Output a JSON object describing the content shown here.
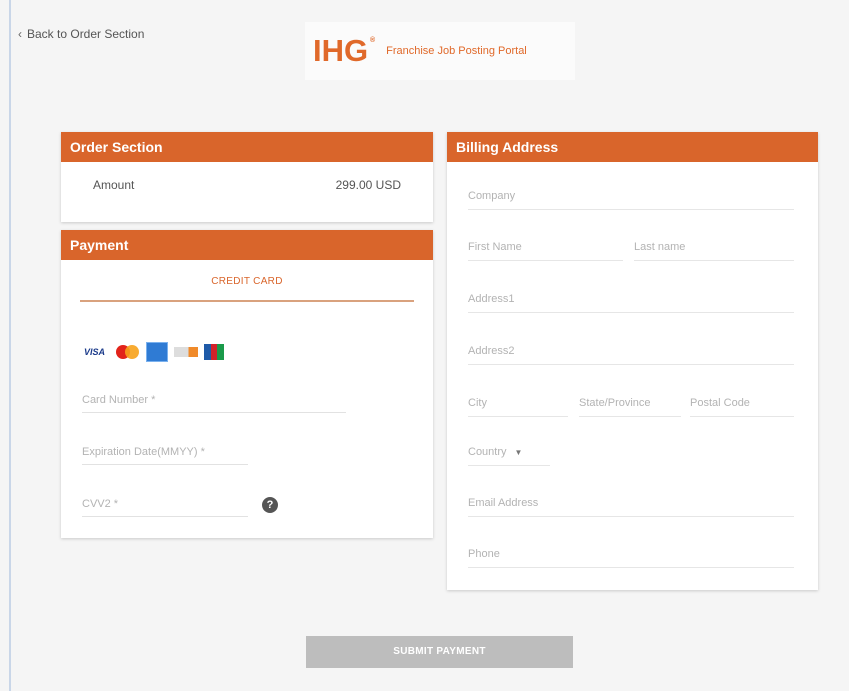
{
  "nav": {
    "back_label": "Back to Order Section"
  },
  "brand": {
    "logo_text": "IHG",
    "logo_mark": "®",
    "portal_title": "Franchise Job Posting Portal",
    "accent": "#d9652b"
  },
  "order": {
    "header": "Order Section",
    "amount_label": "Amount",
    "amount_value": "299.00 USD"
  },
  "payment": {
    "header": "Payment",
    "tab_credit_card": "CREDIT CARD",
    "card_brands": [
      "visa",
      "mastercard",
      "amex",
      "discover",
      "jcb"
    ],
    "visa_label": "VISA",
    "card_number_placeholder": "Card Number *",
    "expiration_placeholder": "Expiration Date(MMYY) *",
    "cvv_placeholder": "CVV2 *",
    "help_glyph": "?"
  },
  "billing": {
    "header": "Billing Address",
    "company": "Company",
    "first_name": "First Name",
    "last_name": "Last name",
    "address1": "Address1",
    "address2": "Address2",
    "city": "City",
    "state": "State/Province",
    "postal": "Postal Code",
    "country": "Country",
    "country_caret": "▼",
    "email": "Email Address",
    "phone": "Phone"
  },
  "actions": {
    "submit_label": "SUBMIT PAYMENT",
    "disabled_color": "#bdbdbd"
  }
}
